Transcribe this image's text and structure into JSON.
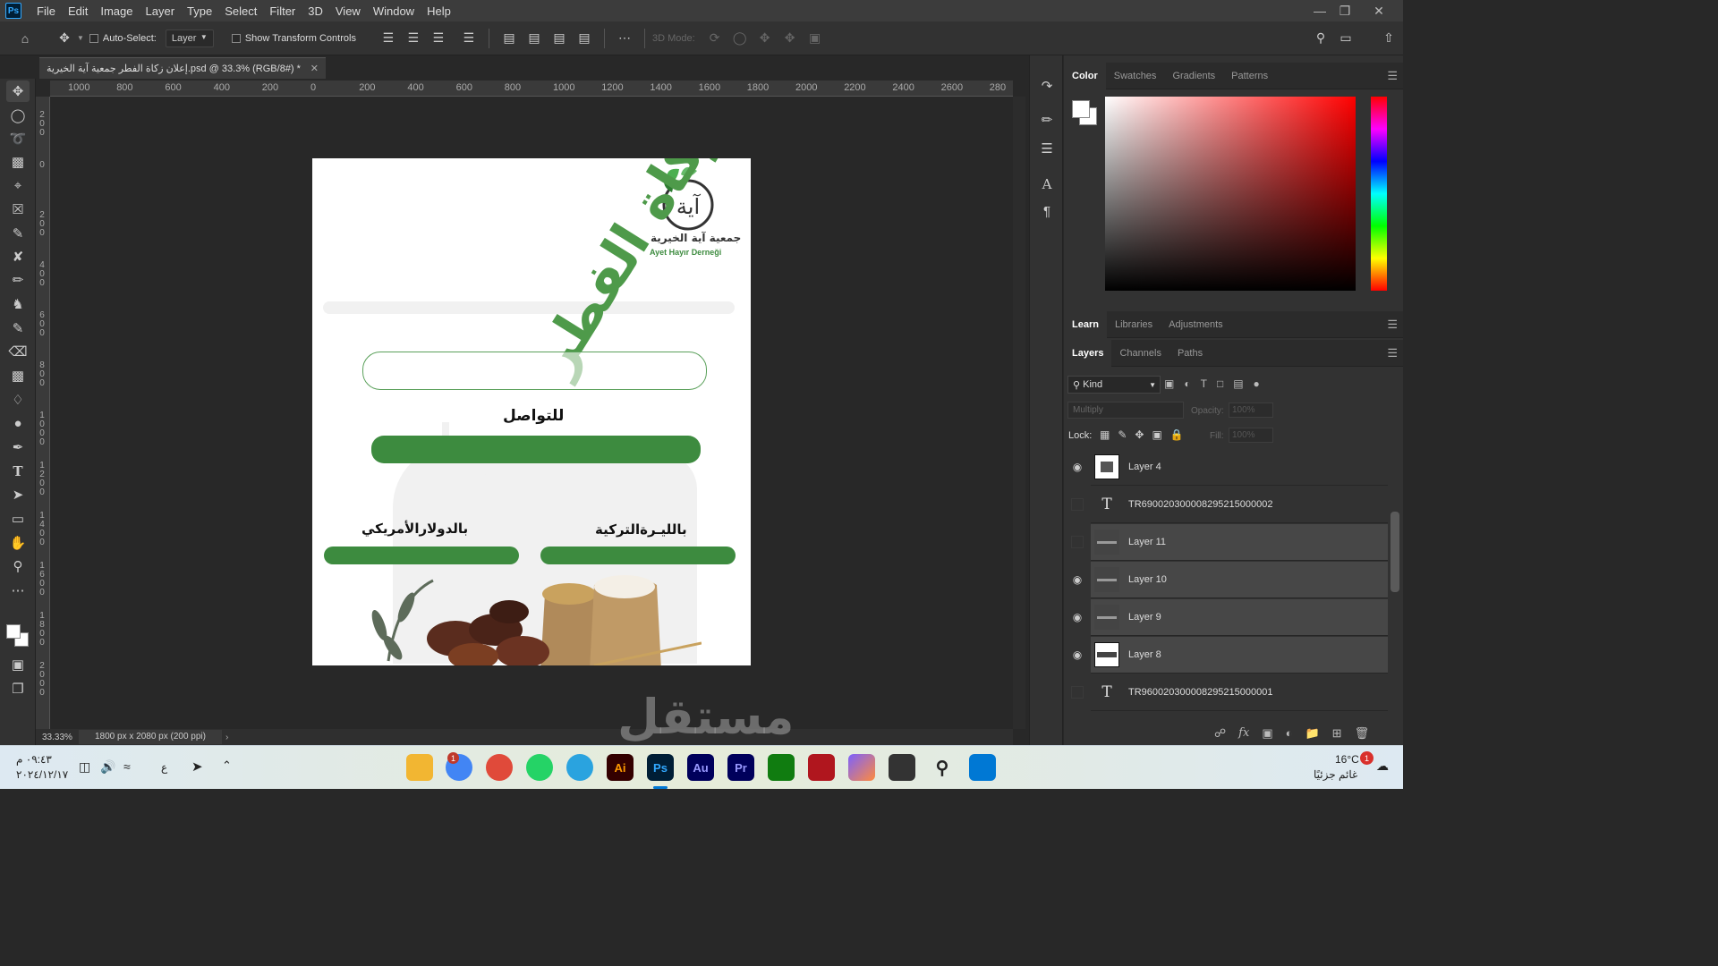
{
  "menubar": {
    "app_icon": "Ps",
    "items": [
      "File",
      "Edit",
      "Image",
      "Layer",
      "Type",
      "Select",
      "Filter",
      "3D",
      "View",
      "Window",
      "Help"
    ]
  },
  "options_bar": {
    "auto_select_label": "Auto-Select:",
    "auto_select_target": "Layer",
    "transform_controls_label": "Show Transform Controls",
    "mode_3d_label": "3D Mode:"
  },
  "document": {
    "tab_title": "إعلان زكاة الفطر جمعية آية الخيرية.psd @ 33.3% (RGB/8#) *",
    "zoom": "33.33%",
    "size_info": "1800 px x 2080 px (200 ppi)"
  },
  "ruler_top": [
    "1000",
    "800",
    "600",
    "400",
    "200",
    "0",
    "200",
    "400",
    "600",
    "800",
    "1000",
    "1200",
    "1400",
    "1600",
    "1800",
    "2000",
    "2200",
    "2400",
    "2600",
    "280"
  ],
  "ruler_left": [
    "2\n0\n0",
    "0",
    "2\n0\n0",
    "4\n0\n0",
    "6\n0\n0",
    "8\n0\n0",
    "1\n0\n0\n0",
    "1\n2\n0\n0",
    "1\n4\n0\n0",
    "1\n6\n0\n0",
    "1\n8\n0\n0",
    "2\n0\n0\n0"
  ],
  "artwork": {
    "title_arabic": "زكاة الفطر",
    "logo_arabic": "جمعية آية الخيرية",
    "logo_latin": "Ayet Hayır Derneği",
    "contact_label": "للتواصل",
    "usd_label": "بالدولارالأمريكي",
    "try_label": "بالليـرةالتركية"
  },
  "color_panel": {
    "tabs": [
      "Color",
      "Swatches",
      "Gradients",
      "Patterns"
    ],
    "active_tab": "Color"
  },
  "learn_panel": {
    "tabs": [
      "Learn",
      "Libraries",
      "Adjustments"
    ],
    "active_tab": "Learn"
  },
  "layers_panel": {
    "tabs": [
      "Layers",
      "Channels",
      "Paths"
    ],
    "active_tab": "Layers",
    "filter_kind": "Kind",
    "blend_mode": "Multiply",
    "opacity_label": "Opacity:",
    "opacity_value": "100%",
    "lock_label": "Lock:",
    "fill_label": "Fill:",
    "fill_value": "100%",
    "layers": [
      {
        "name": "Layer 4",
        "type": "image",
        "visible": true,
        "selected": false
      },
      {
        "name": "TR690020300008295215000002",
        "type": "text",
        "visible": false,
        "selected": false
      },
      {
        "name": "Layer 11",
        "type": "image",
        "visible": false,
        "selected": true
      },
      {
        "name": "Layer 10",
        "type": "image",
        "visible": true,
        "selected": true
      },
      {
        "name": "Layer 9",
        "type": "image",
        "visible": true,
        "selected": true
      },
      {
        "name": "Layer 8",
        "type": "image",
        "visible": true,
        "selected": true
      },
      {
        "name": "TR960020300008295215000001",
        "type": "text",
        "visible": false,
        "selected": false
      }
    ]
  },
  "taskbar": {
    "time": "٠٩:٤٣ م",
    "date": "٢٠٢٤/١٢/١٧",
    "lang": "ع",
    "weather_temp": "16°C",
    "weather_desc": "غائم جزئيًا",
    "notification_count": "1",
    "chrome_badge": "1",
    "apps": [
      {
        "name": "File Explorer",
        "label": "",
        "color": "#f2b632"
      },
      {
        "name": "Chrome Profile",
        "label": "",
        "color": "#4285f4"
      },
      {
        "name": "Chrome",
        "label": "",
        "color": "#e04a3a"
      },
      {
        "name": "WhatsApp",
        "label": "",
        "color": "#25d366"
      },
      {
        "name": "Telegram",
        "label": "",
        "color": "#2aa3df"
      },
      {
        "name": "Illustrator",
        "label": "Ai",
        "color": "#330000"
      },
      {
        "name": "Photoshop",
        "label": "Ps",
        "color": "#001e36"
      },
      {
        "name": "Audition",
        "label": "Au",
        "color": "#00005b"
      },
      {
        "name": "Premiere",
        "label": "Pr",
        "color": "#00005b"
      },
      {
        "name": "Xbox",
        "label": "",
        "color": "#107c10"
      },
      {
        "name": "Red App",
        "label": "",
        "color": "#b0161e"
      },
      {
        "name": "Copilot",
        "label": "",
        "color": "#7b61ff"
      },
      {
        "name": "Terminal",
        "label": "",
        "color": "#333333"
      },
      {
        "name": "Search",
        "label": "",
        "color": "#dde9f2"
      },
      {
        "name": "Start",
        "label": "",
        "color": "#0078d4"
      }
    ]
  },
  "watermark": "مستقل"
}
